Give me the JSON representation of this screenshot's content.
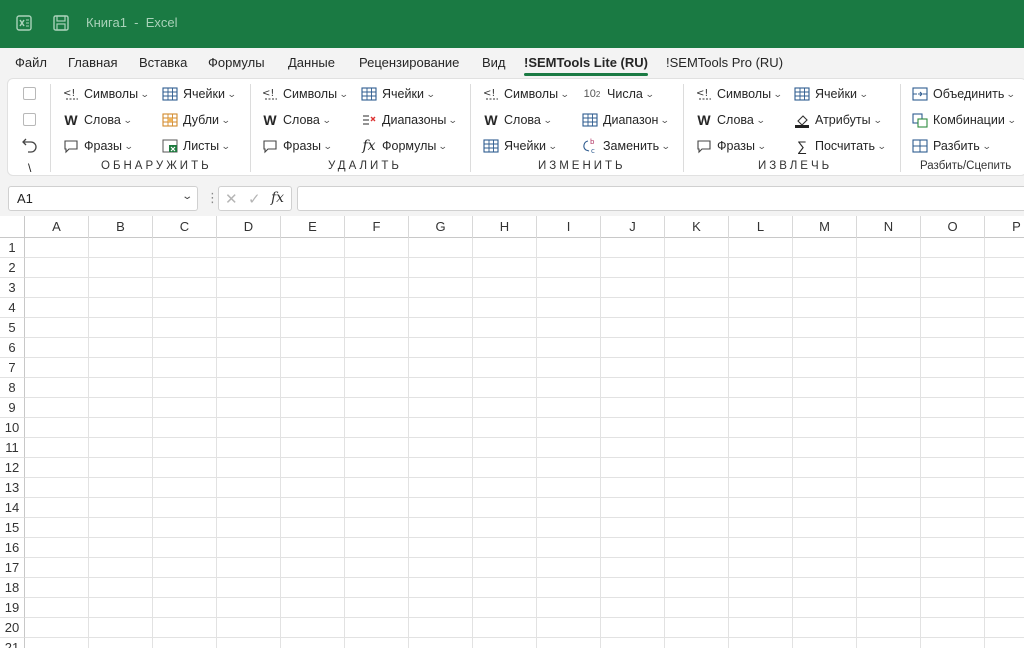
{
  "app": {
    "window_title": "Книга1  -  Excel",
    "accent_color": "#1a7a43"
  },
  "menu": {
    "tabs": [
      "Файл",
      "Главная",
      "Вставка",
      "Формулы",
      "Данные",
      "Рецензирование",
      "Вид",
      "!SEMTools Lite (RU)",
      "!SEMTools Pro (RU)"
    ],
    "active_tab": "!SEMTools Lite (RU)"
  },
  "ribbon": {
    "misc": {
      "undo_icon": "undo-icon",
      "backslash": "\\"
    },
    "groups": {
      "find": {
        "label": "ОБНАРУЖИТЬ",
        "symbols": "Символы",
        "words": "Слова",
        "phrases": "Фразы",
        "cells": "Ячейки",
        "duplicates": "Дубли",
        "sheets": "Листы"
      },
      "remove": {
        "label": "УДАЛИТЬ",
        "symbols": "Символы",
        "words": "Слова",
        "phrases": "Фразы",
        "cells": "Ячейки",
        "ranges": "Диапазоны",
        "formulas": "Формулы"
      },
      "change": {
        "label": "ИЗМЕНИТЬ",
        "symbols": "Символы",
        "words": "Слова",
        "cells": "Ячейки",
        "numbers": "Числа",
        "numbers_icon_text": "10",
        "numbers_icon_sup": "2",
        "range": "Диапазон",
        "replace": "Заменить"
      },
      "extract": {
        "label": "ИЗВЛЕЧЬ",
        "symbols": "Символы",
        "words": "Слова",
        "phrases": "Фразы",
        "cells": "Ячейки",
        "attributes": "Атрибуты",
        "count": "Посчитать"
      },
      "split": {
        "label": "Разбить/Сцепить",
        "merge": "Объединить",
        "combinations": "Комбинации",
        "split": "Разбить"
      }
    }
  },
  "formula_bar": {
    "name_box_value": "A1",
    "dots": "⋮",
    "fx_label": "fx",
    "cancel_glyph": "✕",
    "enter_glyph": "✓",
    "formula_value": ""
  },
  "sheet": {
    "columns": [
      "A",
      "B",
      "C",
      "D",
      "E",
      "F",
      "G",
      "H",
      "I",
      "J",
      "K",
      "L",
      "M",
      "N",
      "O",
      "P"
    ],
    "rows": [
      "1",
      "2",
      "3",
      "4",
      "5",
      "6",
      "7",
      "8",
      "9",
      "10",
      "11",
      "12",
      "13",
      "14",
      "15",
      "16",
      "17",
      "18",
      "19",
      "20",
      "21"
    ]
  }
}
